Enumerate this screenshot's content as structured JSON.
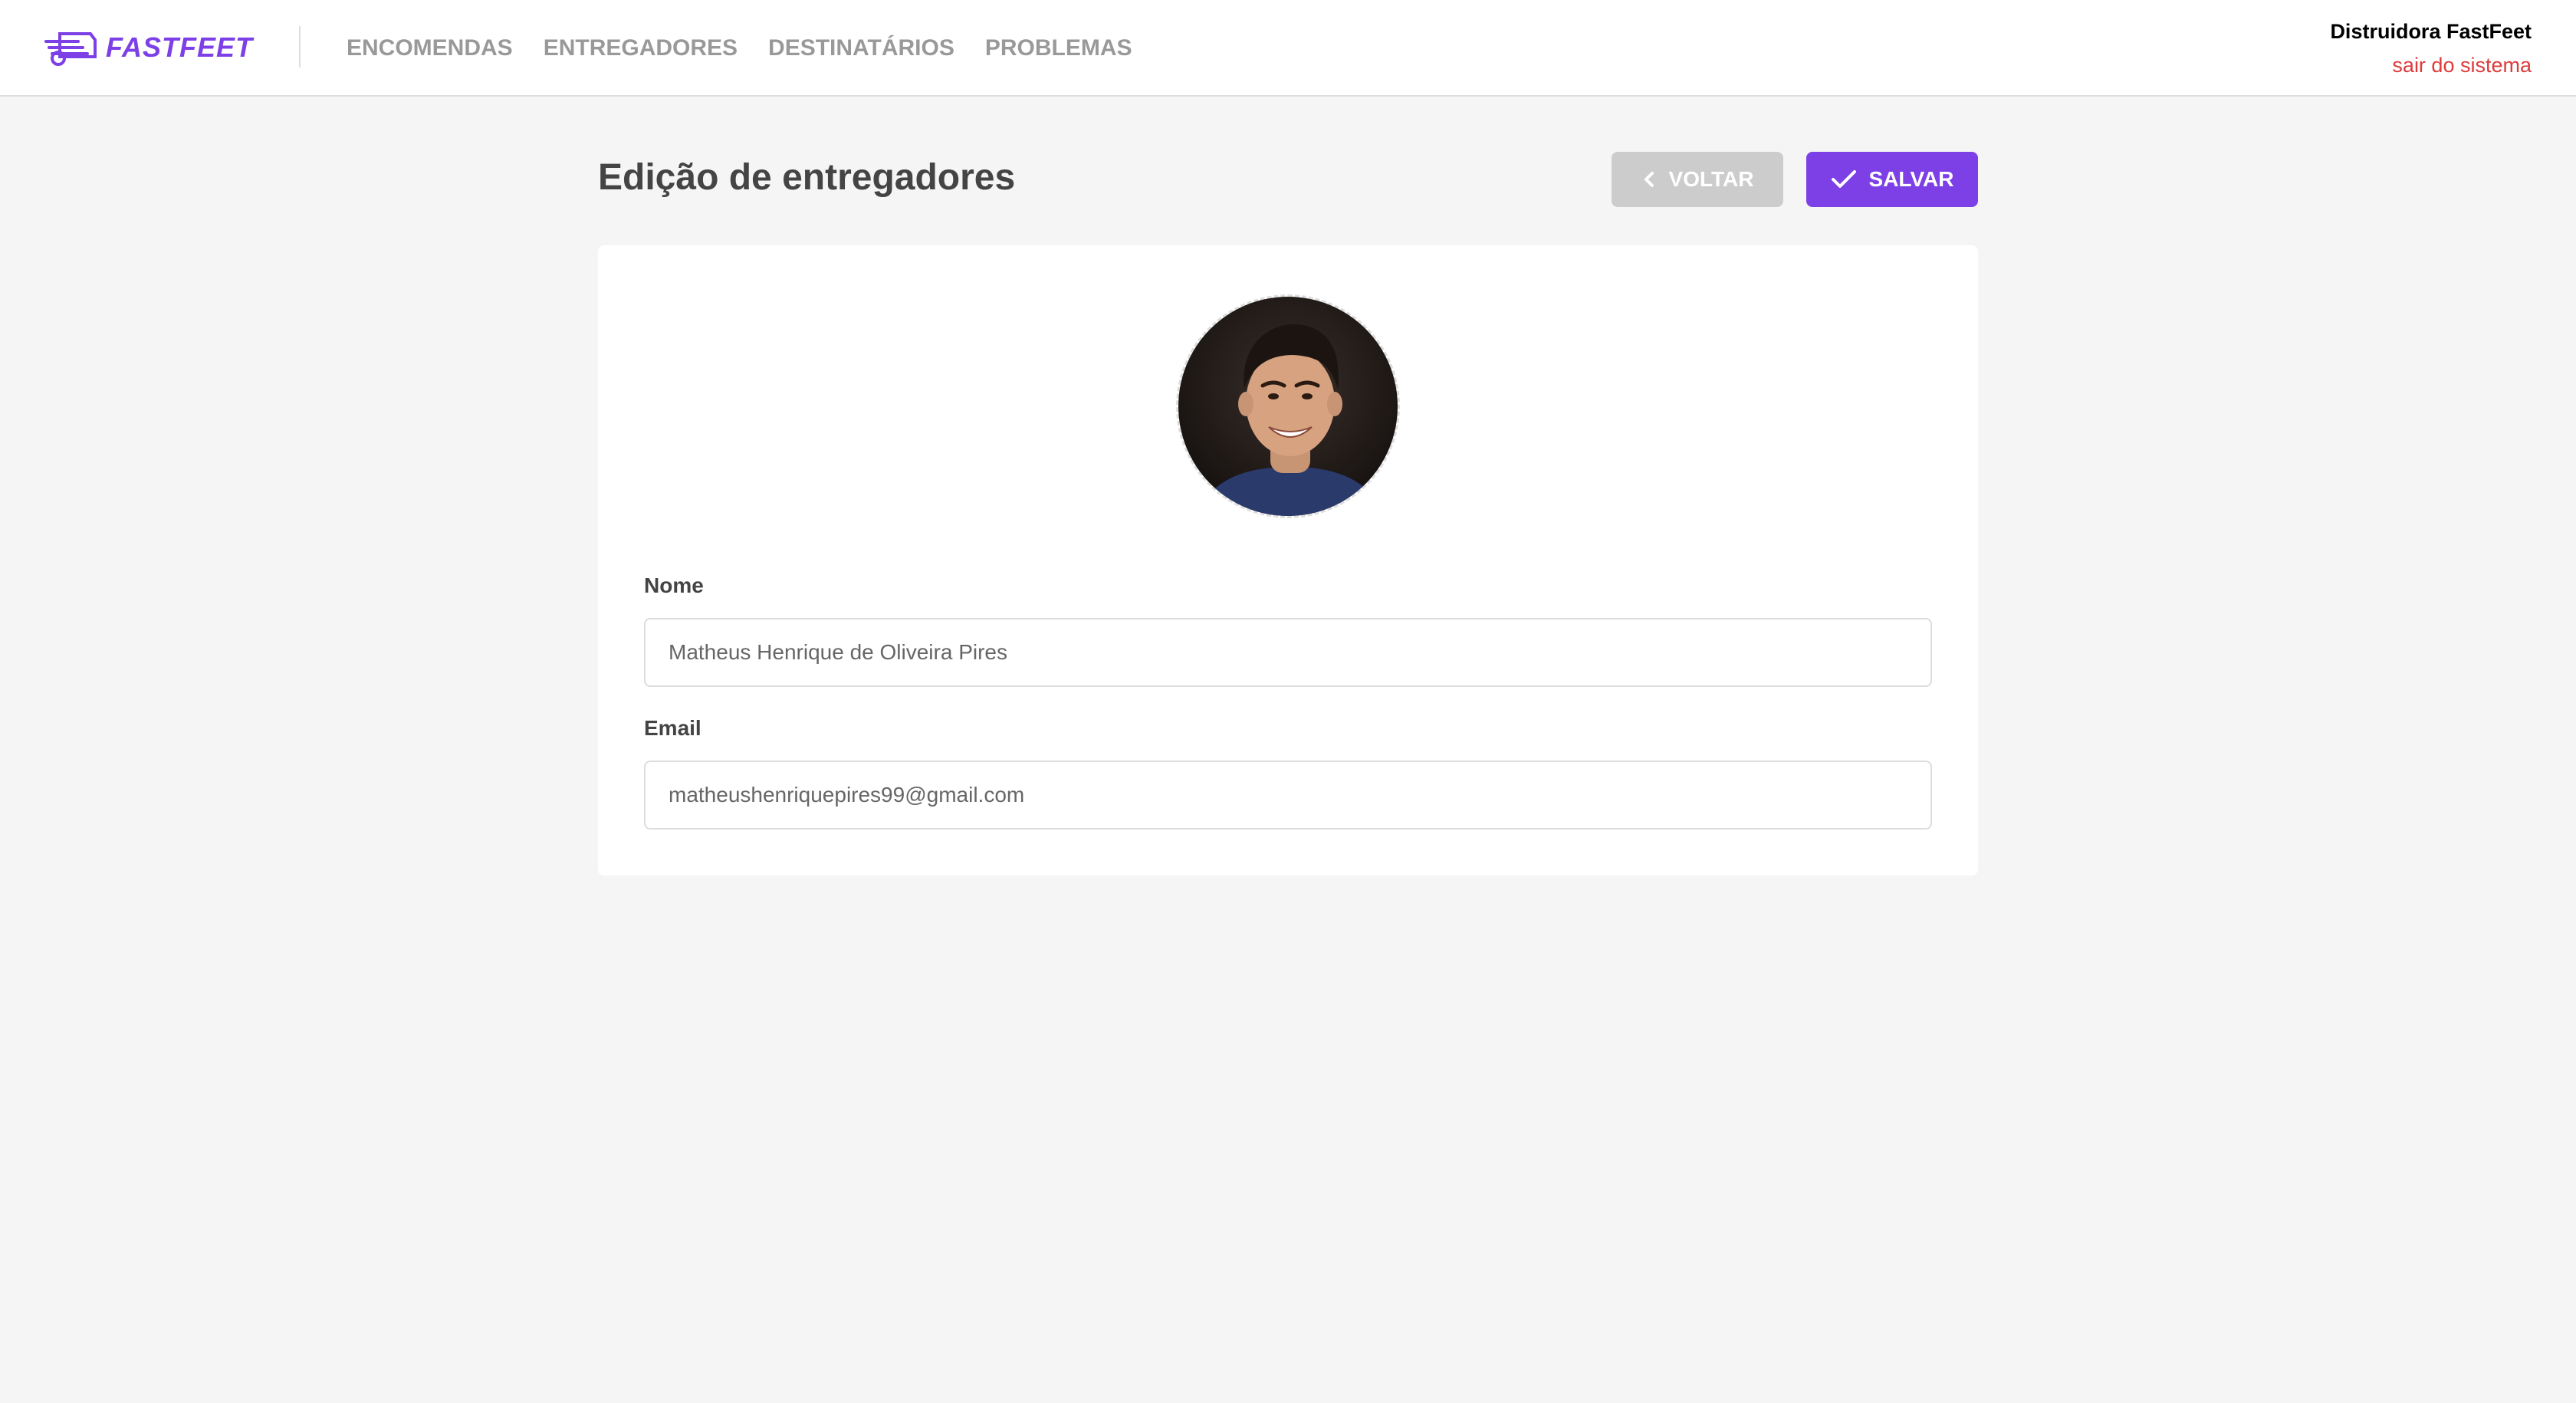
{
  "app": {
    "logo_text": "FASTFEET",
    "brand_color": "#7d40e7"
  },
  "nav": {
    "items": [
      {
        "label": "ENCOMENDAS"
      },
      {
        "label": "ENTREGADORES"
      },
      {
        "label": "DESTINATÁRIOS"
      },
      {
        "label": "PROBLEMAS"
      }
    ]
  },
  "user": {
    "name": "Distruidora FastFeet",
    "logout_label": "sair do sistema",
    "logout_color": "#de3b3b"
  },
  "page": {
    "title": "Edição de entregadores"
  },
  "actions": {
    "back_label": "VOLTAR",
    "back_icon": "chevron-left-icon",
    "save_label": "SALVAR",
    "save_icon": "check-icon"
  },
  "form": {
    "avatar_icon": "avatar-photo",
    "name_label": "Nome",
    "name_value": "Matheus Henrique de Oliveira Pires",
    "email_label": "Email",
    "email_value": "matheushenriquepires99@gmail.com"
  }
}
